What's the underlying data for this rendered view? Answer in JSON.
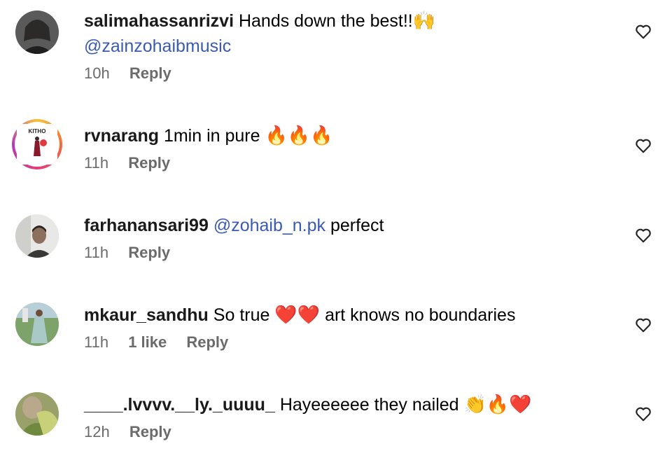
{
  "comments": [
    {
      "username": "salimahassanrizvi",
      "text": "Hands down the best!!",
      "emoji": "🙌",
      "mention": "@zainzohaibmusic",
      "time": "10h",
      "reply_label": "Reply"
    },
    {
      "username": "rvnarang",
      "text": "1min in pure",
      "emoji": "🔥🔥🔥",
      "avatar_text": "KITHO",
      "time": "11h",
      "reply_label": "Reply"
    },
    {
      "username": "farhanansari99",
      "mention": "@zohaib_n.pk",
      "text": "perfect",
      "time": "11h",
      "reply_label": "Reply"
    },
    {
      "username": "mkaur_sandhu",
      "text": "So true",
      "emoji": "❤️❤️",
      "text_after": "art knows no boundaries",
      "time": "11h",
      "likes": "1 like",
      "reply_label": "Reply"
    },
    {
      "username": "____.lvvvv.__ly._uuuu_",
      "text": "Hayeeeeee they nailed",
      "emoji": "👏🔥❤️",
      "time": "12h",
      "reply_label": "Reply"
    }
  ],
  "icons": {
    "like": "heart-outline-icon"
  },
  "colors": {
    "mention": "#3b5bb3",
    "meta": "#6b6b6b"
  }
}
